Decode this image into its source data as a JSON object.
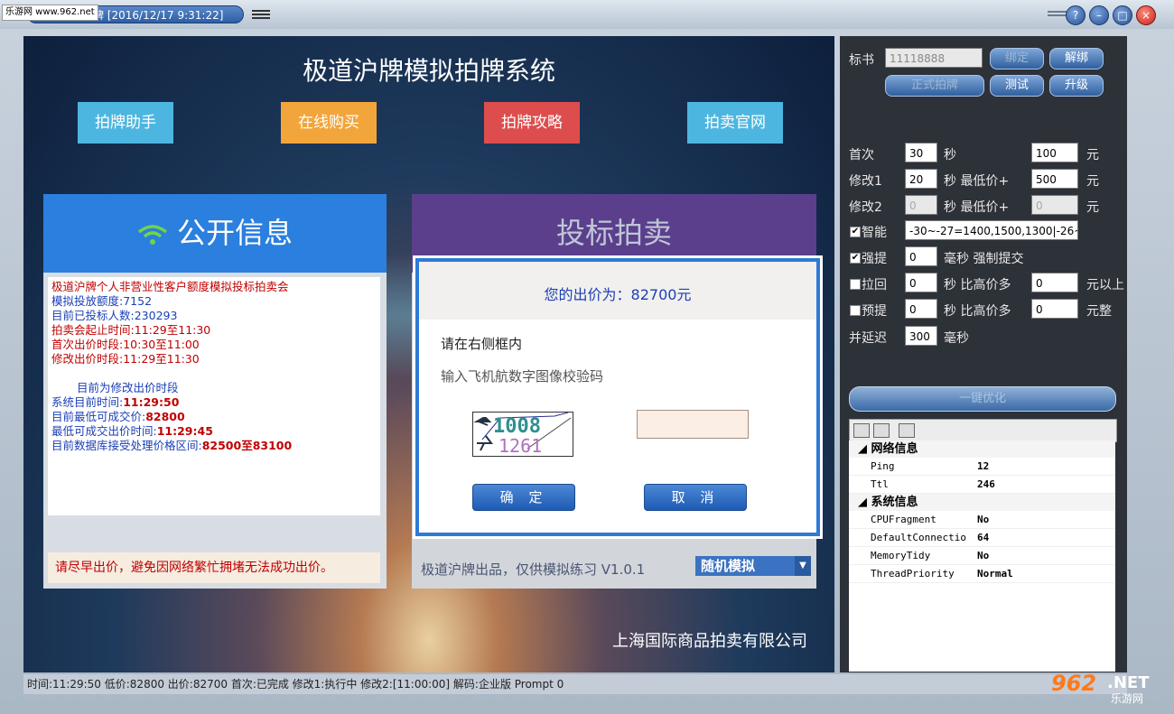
{
  "window": {
    "title": "极道沪牌 [2016/12/17 9:31:22]",
    "site_badge": "乐游网 www.962.net",
    "help": "?",
    "min": "–",
    "restore": "□",
    "close": "×"
  },
  "stage": {
    "title": "极道沪牌模拟拍牌系统",
    "nav": [
      "拍牌助手",
      "在线购买",
      "拍牌攻略",
      "拍卖官网"
    ],
    "company": "上海国际商品拍卖有限公司"
  },
  "public_info": {
    "heading": "公开信息",
    "lines": [
      "极道沪牌个人非营业性客户额度模拟投标拍卖会",
      "模拟投放额度:7152",
      "目前已投标人数:230293",
      "拍卖会起止时间:11:29至11:30",
      "首次出价时段:10:30至11:00",
      "修改出价时段:11:29至11:30"
    ],
    "stage_line": "目前为修改出价时段",
    "sys_time_label": "系统目前时间:",
    "sys_time": "11:29:50",
    "min_price_label": "目前最低可成交价:",
    "min_price": "82800",
    "min_time_label": "最低可成交出价时间:",
    "min_time": "11:29:45",
    "range_label": "目前数据库接受处理价格区间:",
    "range": "82500至83100",
    "warning": "请尽早出价，避免因网络繁忙拥堵无法成功出价。"
  },
  "auction": {
    "heading": "投标拍卖",
    "footer_text": "极道沪牌出品，仅供模拟练习 V1.0.1",
    "mode_select": "随机模拟"
  },
  "dialog": {
    "title": "您的出价为：82700元",
    "line1": "请在右侧框内",
    "line2": "输入飞机航数字图像校验码",
    "captcha_top": "1008",
    "captcha_bottom": "1261",
    "ok": "确 定",
    "cancel": "取 消"
  },
  "panel": {
    "bid_label": "标书",
    "bid_value": "11118888",
    "btn_bind": "绑定",
    "btn_unbind": "解绑",
    "btn_formal": "正式拍牌",
    "btn_test": "测试",
    "btn_upgrade": "升级",
    "rows": {
      "first": {
        "label": "首次",
        "sec": "30",
        "unit1": "秒",
        "price": "100",
        "unit2": "元"
      },
      "mod1": {
        "label": "修改1",
        "sec": "20",
        "unit1": "秒 最低价+",
        "price": "500",
        "unit2": "元"
      },
      "mod2": {
        "label": "修改2",
        "sec": "0",
        "unit1": "秒 最低价+",
        "price": "0",
        "unit2": "元"
      },
      "smart": {
        "label": "智能",
        "value": "-30~-27=1400,1500,1300|-26~"
      },
      "force": {
        "label": "强提",
        "ms": "0",
        "unit": "毫秒 强制提交"
      },
      "pull": {
        "label": "拉回",
        "sec": "0",
        "unit1": "秒 比高价多",
        "amt": "0",
        "unit2": "元以上"
      },
      "pre": {
        "label": "预提",
        "sec": "0",
        "unit1": "秒 比高价多",
        "amt": "0",
        "unit2": "元整"
      },
      "delay": {
        "label": "并延迟",
        "ms": "300",
        "unit": "毫秒"
      }
    },
    "optimize": "一键优化"
  },
  "propgrid": {
    "cat_network": "网络信息",
    "ping_k": "Ping",
    "ping_v": "12",
    "ttl_k": "Ttl",
    "ttl_v": "246",
    "cat_system": "系统信息",
    "cpu_k": "CPUFragment",
    "cpu_v": "No",
    "dc_k": "DefaultConnectio",
    "dc_v": "64",
    "mem_k": "MemoryTidy",
    "mem_v": "No",
    "tp_k": "ThreadPriority",
    "tp_v": "Normal"
  },
  "status": "时间:11:29:50  低价:82800 出价:82700   首次:已完成 修改1:执行中 修改2:[11:00:00] 解码:企业版 Prompt 0",
  "watermark": {
    "num": "962",
    "net": ".NET",
    "cn": "乐游网"
  }
}
